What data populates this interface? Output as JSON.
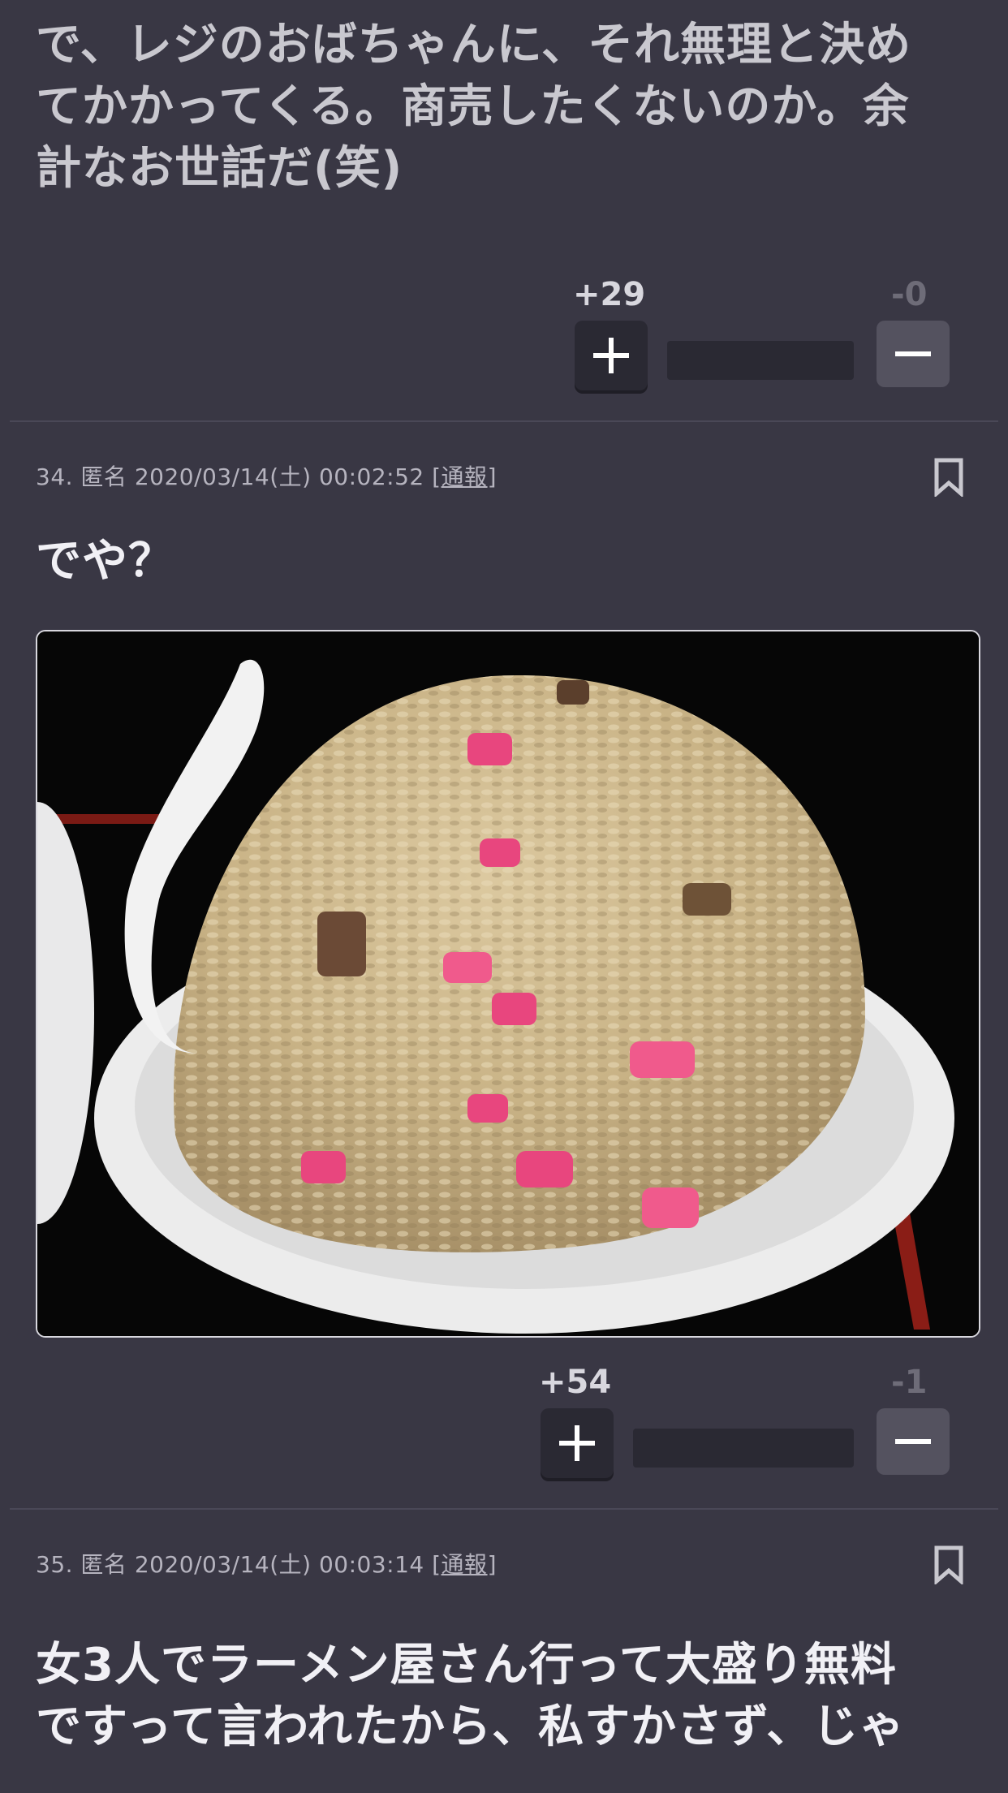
{
  "comments": [
    {
      "text_lines": [
        "で、レジのおばちゃんに、それ無理と決め",
        "てかかってくる。商売したくないのか。余",
        "計なお世話だ(笑)"
      ],
      "plus": "+29",
      "minus": "-0"
    },
    {
      "meta_prefix": "34. 匿名 2020/03/14(土) 00:02:52 [",
      "report_label": "通報",
      "meta_suffix": "]",
      "text": "でや？",
      "plus": "+54",
      "minus": "-1"
    },
    {
      "meta_prefix": "35. 匿名 2020/03/14(土) 00:03:14 [",
      "report_label": "通報",
      "meta_suffix": "]",
      "text_lines": [
        "女3人でラーメン屋さん行って大盛り無料",
        "ですって言われたから、私すかさず、じゃ"
      ]
    }
  ],
  "icons": {
    "bookmark": "bookmark-icon",
    "plus": "plus-icon",
    "minus": "minus-icon"
  },
  "colors": {
    "background": "#393744",
    "button_dark": "#2a2933",
    "button_minus": "#54525f"
  }
}
